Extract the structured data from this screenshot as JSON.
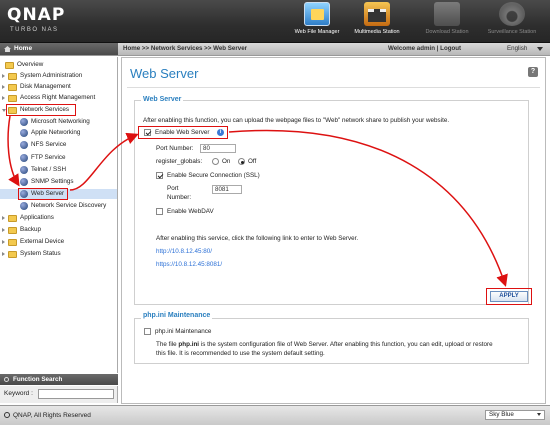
{
  "header": {
    "logo": "QNAP",
    "logo_sub": "TURBO NAS",
    "apps": [
      {
        "label": "Web File Manager",
        "icon": "folder-icon"
      },
      {
        "label": "Multimedia Station",
        "icon": "film-icon"
      },
      {
        "label": "Download Station",
        "icon": "download-icon"
      },
      {
        "label": "Surveillance Station",
        "icon": "camera-icon"
      }
    ]
  },
  "subbar": {
    "home": "Home",
    "breadcrumb": "Home >> Network Services >> Web Server",
    "welcome": "Welcome admin | Logout",
    "language": "English"
  },
  "sidebar": {
    "items": [
      {
        "label": "Overview"
      },
      {
        "label": "System Administration"
      },
      {
        "label": "Disk Management"
      },
      {
        "label": "Access Right Management"
      },
      {
        "label": "Network Services"
      },
      {
        "label": "Microsoft Networking"
      },
      {
        "label": "Apple Networking"
      },
      {
        "label": "NFS Service"
      },
      {
        "label": "FTP Service"
      },
      {
        "label": "Telnet / SSH"
      },
      {
        "label": "SNMP Settings"
      },
      {
        "label": "Web Server"
      },
      {
        "label": "Network Service Discovery"
      },
      {
        "label": "Applications"
      },
      {
        "label": "Backup"
      },
      {
        "label": "External Device"
      },
      {
        "label": "System Status"
      }
    ],
    "function_search": {
      "title": "Function Search",
      "keyword_label": "Keyword :",
      "value": ""
    }
  },
  "main": {
    "title": "Web Server",
    "help": "?",
    "web_server": {
      "section_title": "Web Server",
      "description": "After enabling this function, you can upload the webpage files to \"Web\" network share to publish your website.",
      "enable_label": "Enable Web Server",
      "enable_checked": true,
      "port_label": "Port Number:",
      "port_value": "80",
      "register_globals_label": "register_globals:",
      "on_label": "On",
      "off_label": "Off",
      "register_globals_value": "Off",
      "ssl_label": "Enable Secure Connection (SSL)",
      "ssl_checked": true,
      "ssl_port_label_1": "Port",
      "ssl_port_label_2": "Number:",
      "ssl_port_value": "8081",
      "webdav_label": "Enable WebDAV",
      "webdav_checked": false,
      "link_note": "After enabling this service, click the following link to enter to Web Server.",
      "link_http": "http://10.8.12.45:80/",
      "link_https": "https://10.8.12.45:8081/",
      "apply": "APPLY"
    },
    "php": {
      "section_title": "php.ini Maintenance",
      "checkbox_label": "php.ini Maintenance",
      "checked": false,
      "desc_line1_a": "The file ",
      "desc_line1_b": "php.ini",
      "desc_line1_c": " is the system configuration file of Web Server. After enabling this function, you can edit, upload or restore",
      "desc_line2": "this file. It is recommended to use the system default setting."
    }
  },
  "footer": {
    "copyright": "QNAP, All Rights Reserved",
    "skin": "Sky Blue"
  },
  "colors": {
    "accent": "#2a7fbf",
    "highlight": "#d11111",
    "link": "#2a6fd6"
  }
}
